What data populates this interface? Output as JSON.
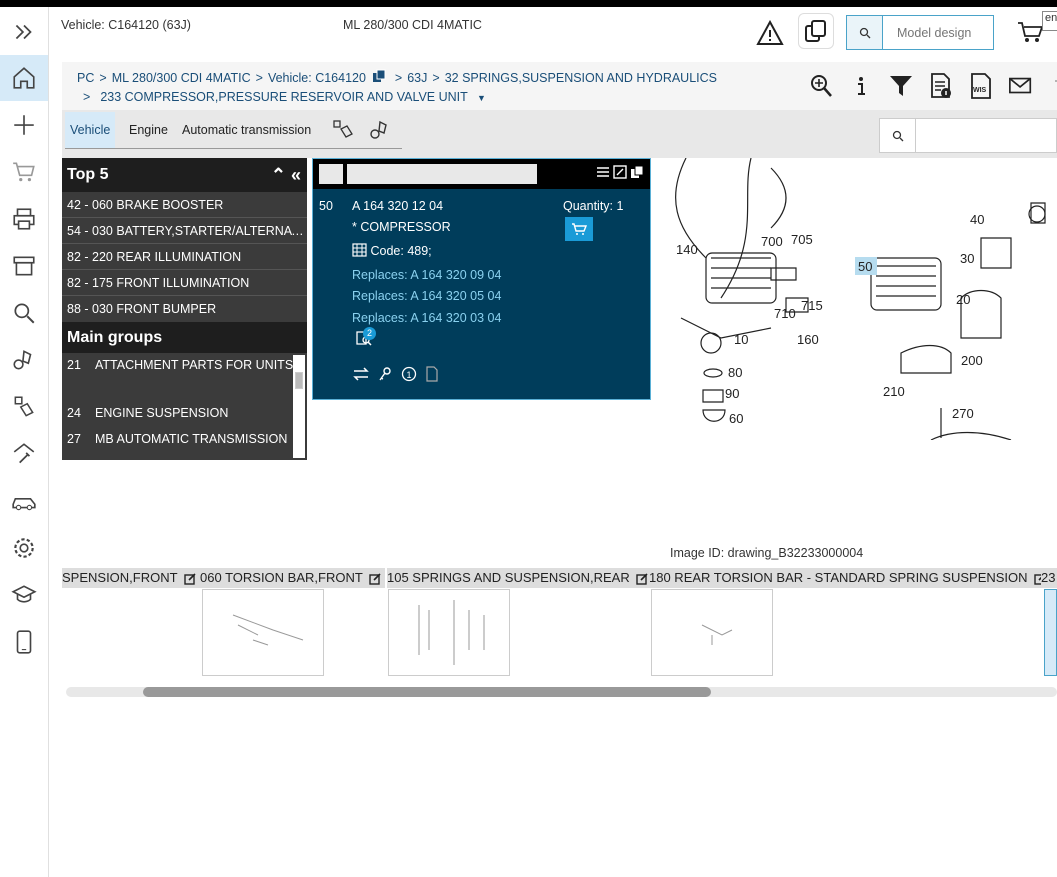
{
  "header": {
    "vehicle": "Vehicle: C164120 (63J)",
    "model": "ML 280/300 CDI 4MATIC",
    "search_placeholder": "Model design",
    "lang": "en"
  },
  "breadcrumb": {
    "items": [
      "PC",
      "ML 280/300 CDI 4MATIC",
      "Vehicle: C164120",
      "63J",
      "32 SPRINGS,SUSPENSION AND HYDRAULICS"
    ],
    "sub": "233 COMPRESSOR,PRESSURE RESERVOIR AND VALVE UNIT"
  },
  "tabs": [
    "Vehicle",
    "Engine",
    "Automatic transmission"
  ],
  "top5": {
    "title": "Top 5",
    "items": [
      "42 - 060 BRAKE BOOSTER",
      "54 - 030 BATTERY,STARTER/ALTERNAT...",
      "82 - 220 REAR ILLUMINATION",
      "82 - 175 FRONT ILLUMINATION",
      "88 - 030 FRONT BUMPER"
    ]
  },
  "main_groups": {
    "title": "Main groups",
    "items": [
      {
        "num": "21",
        "label": "ATTACHMENT PARTS FOR UNITS"
      },
      {
        "num": "24",
        "label": "ENGINE SUSPENSION"
      },
      {
        "num": "27",
        "label": "MB AUTOMATIC TRANSMISSION"
      }
    ]
  },
  "detail": {
    "pos": "50",
    "part_no": "A 164 320 12 04",
    "name": "* COMPRESSOR",
    "code": "Code: 489;",
    "quantity": "Quantity: 1",
    "replaces": [
      "Replaces: A 164 320 09 04",
      "Replaces: A 164 320 05 04",
      "Replaces: A 164 320 03 04"
    ],
    "badge": "2"
  },
  "drawing": {
    "labels": [
      "140",
      "700",
      "705",
      "715",
      "710",
      "160",
      "10",
      "80",
      "90",
      "60",
      "50",
      "40",
      "30",
      "20",
      "200",
      "210",
      "270"
    ],
    "image_id": "Image ID: drawing_B32233000004"
  },
  "strip": {
    "labels": [
      "SPENSION,FRONT",
      "060 TORSION BAR,FRONT",
      "105 SPRINGS AND SUSPENSION,REAR",
      "180 REAR TORSION BAR - STANDARD SPRING SUSPENSION",
      "23"
    ]
  }
}
